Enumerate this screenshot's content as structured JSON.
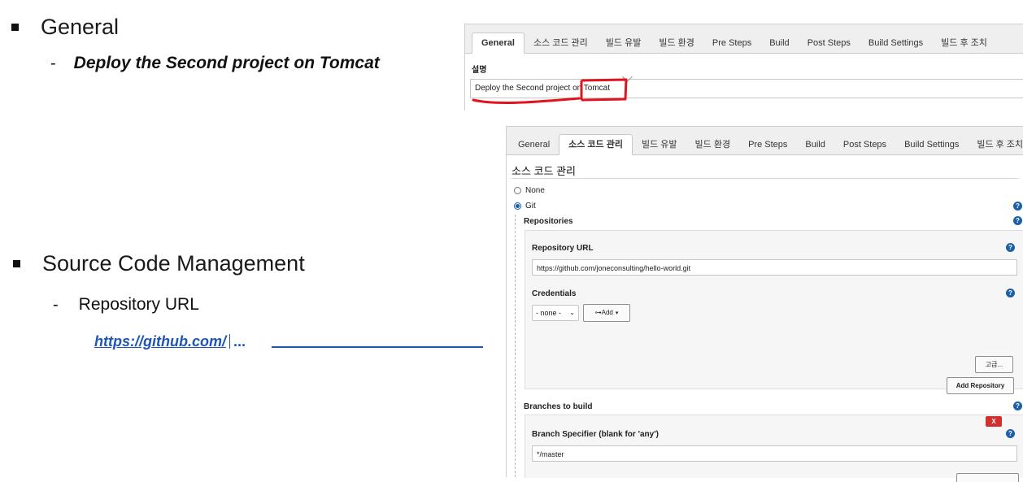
{
  "slide": {
    "general_title": "General",
    "general_dash": "-",
    "general_desc": "Deploy the Second project on Tomcat",
    "scm_title": "Source Code Management",
    "scm_dash": "-",
    "scm_sub": "Repository URL",
    "repo_link": "https://github.com/",
    "ellipsis": "..."
  },
  "tabs": [
    "General",
    "소스 코드 관리",
    "빌드 유발",
    "빌드 환경",
    "Pre Steps",
    "Build",
    "Post Steps",
    "Build Settings",
    "빌드 후 조치"
  ],
  "general_panel": {
    "active_tab": "General",
    "desc_label": "설명",
    "desc_value": "Deploy the Second project on Tomcat"
  },
  "scm_panel": {
    "active_tab": "소스 코드 관리",
    "heading": "소스 코드 관리",
    "none_label": "None",
    "git_label": "Git",
    "repositories_label": "Repositories",
    "repo_url_label": "Repository URL",
    "repo_url_value": "https://github.com/joneconsulting/hello-world.git",
    "credentials_label": "Credentials",
    "credentials_select": "- none -",
    "add_button": "Add",
    "advanced_button": "고급...",
    "add_repository_button": "Add Repository",
    "branches_label": "Branches to build",
    "delete_button": "X",
    "branch_spec_label": "Branch Specifier (blank for 'any')",
    "branch_spec_value": "*/master",
    "help_glyph": "?",
    "selected_scm": "Git"
  },
  "colors": {
    "link": "#1f56b3",
    "annotation_red": "#e0141e",
    "help_blue": "#1d5fa8",
    "delete_red": "#d32f2f"
  }
}
